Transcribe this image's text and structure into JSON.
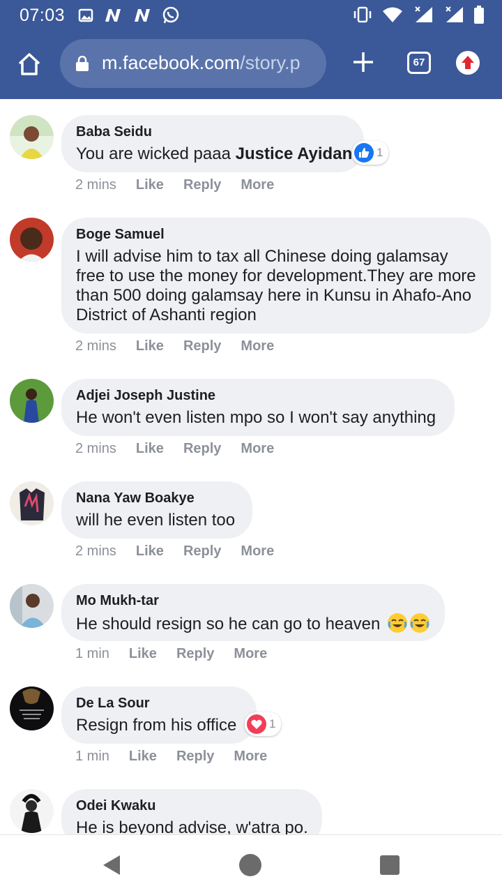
{
  "status_bar": {
    "time": "07:03",
    "left_icons": [
      "image-icon",
      "n-notification-icon",
      "n-notification-icon",
      "whatsapp-icon"
    ],
    "right_icons": [
      "vibrate-icon",
      "wifi-icon",
      "signal-icon",
      "signal-icon",
      "battery-icon"
    ]
  },
  "browser": {
    "url_host": "m.facebook.com",
    "url_path": "/story.p",
    "tab_count": "67",
    "colors": {
      "bar": "#3b5998",
      "url_box": "#5a74ab"
    }
  },
  "comments": [
    {
      "author": "Baba Seidu",
      "text_pre": "You are wicked paaa ",
      "text_bold": "Justice Ayidan",
      "time": "2 mins",
      "like": "Like",
      "reply": "Reply",
      "more": "More",
      "reaction": "like",
      "reaction_count": "1"
    },
    {
      "author": "Boge Samuel",
      "text_pre": "I will advise him to tax all Chinese doing galamsay free to use the money for development.They are more than 500 doing galamsay here in Kunsu in Ahafo-Ano District of Ashanti region",
      "time": "2 mins",
      "like": "Like",
      "reply": "Reply",
      "more": "More"
    },
    {
      "author": "Adjei Joseph Justine",
      "text_pre": "He won't even listen mpo so I won't say anything",
      "time": "2 mins",
      "like": "Like",
      "reply": "Reply",
      "more": "More"
    },
    {
      "author": "Nana Yaw Boakye",
      "text_pre": "will he even listen too",
      "time": "2 mins",
      "like": "Like",
      "reply": "Reply",
      "more": "More"
    },
    {
      "author": "Mo Mukh-tar",
      "text_pre": "He should resign so he can go to heaven ",
      "emojis": [
        "tears-of-joy-emoji",
        "tears-of-joy-emoji"
      ],
      "time": "1 min",
      "like": "Like",
      "reply": "Reply",
      "more": "More"
    },
    {
      "author": "De La Sour",
      "text_pre": "Resign from his office",
      "time": "1 min",
      "like": "Like",
      "reply": "Reply",
      "more": "More",
      "reaction": "love",
      "reaction_count": "1"
    },
    {
      "author": "Odei Kwaku",
      "text_pre": "He is beyond advise, w'atra po.",
      "time": "",
      "like": "",
      "reply": "",
      "more": ""
    }
  ],
  "nav": {
    "icons": [
      "back-icon",
      "home-icon",
      "recents-icon"
    ]
  }
}
